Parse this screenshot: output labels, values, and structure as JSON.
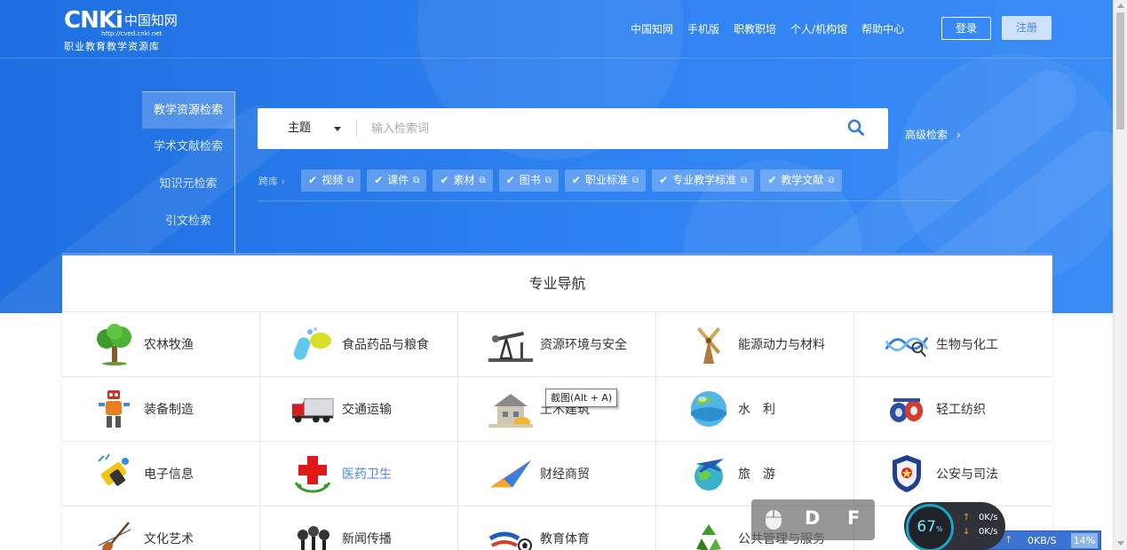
{
  "logo": {
    "brand": "CNKi",
    "cn": "中国知网",
    "url": "http://cved.cnki.net",
    "subtitle": "职业教育教学资源库"
  },
  "topnav": [
    "中国知网",
    "手机版",
    "职教职培",
    "个人/机构馆",
    "帮助中心"
  ],
  "auth": {
    "login": "登录",
    "register": "注册"
  },
  "search_tabs": [
    "教学资源检索",
    "学术文献检索",
    "知识元检索",
    "引文检索"
  ],
  "search": {
    "field": "主题",
    "placeholder": "输入检索词",
    "advanced": "高级检索",
    "advanced_arrow": "›"
  },
  "cross_db": {
    "label": "跨库 ›",
    "items": [
      "视频",
      "课件",
      "素材",
      "图书",
      "职业标准",
      "专业教学标准",
      "教学文献"
    ]
  },
  "nav_card": {
    "title": "专业导航",
    "items": [
      {
        "label": "农林牧渔",
        "icon": "tree-icon"
      },
      {
        "label": "食品药品与粮食",
        "icon": "capsule-icon"
      },
      {
        "label": "资源环境与安全",
        "icon": "oil-pump-icon"
      },
      {
        "label": "能源动力与材料",
        "icon": "windmill-icon"
      },
      {
        "label": "生物与化工",
        "icon": "dna-icon"
      },
      {
        "label": "装备制造",
        "icon": "robot-icon"
      },
      {
        "label": "交通运输",
        "icon": "truck-icon"
      },
      {
        "label": "土木建筑",
        "icon": "building-icon"
      },
      {
        "label": "水　利",
        "icon": "globe-water-icon"
      },
      {
        "label": "轻工纺织",
        "icon": "thread-spools-icon"
      },
      {
        "label": "电子信息",
        "icon": "electronics-icon"
      },
      {
        "label": "医药卫生",
        "icon": "red-cross-icon"
      },
      {
        "label": "财经商贸",
        "icon": "paper-plane-icon"
      },
      {
        "label": "旅　游",
        "icon": "airplane-globe-icon"
      },
      {
        "label": "公安与司法",
        "icon": "police-badge-icon"
      },
      {
        "label": "文化艺术",
        "icon": "violin-icon"
      },
      {
        "label": "新闻传播",
        "icon": "microphone-icon"
      },
      {
        "label": "教育体育",
        "icon": "sports-icon"
      },
      {
        "label": "公共管理与服务",
        "icon": "recycle-icon"
      },
      {
        "label": "",
        "icon": "hidden-icon"
      }
    ]
  },
  "tooltip": "截图(Alt + A)",
  "float_widget": {
    "key1": "D",
    "key2": "F"
  },
  "speed_meter": {
    "percent": "67",
    "percent_unit": "%",
    "up": "0K/s",
    "down": "0K/s",
    "bar_speed": "0KB/S",
    "bar_pct": "14%"
  },
  "colors": {
    "hero_blue": "#2a7bea",
    "link_blue": "#4a86e8",
    "card_accent": "#5a95ee"
  }
}
